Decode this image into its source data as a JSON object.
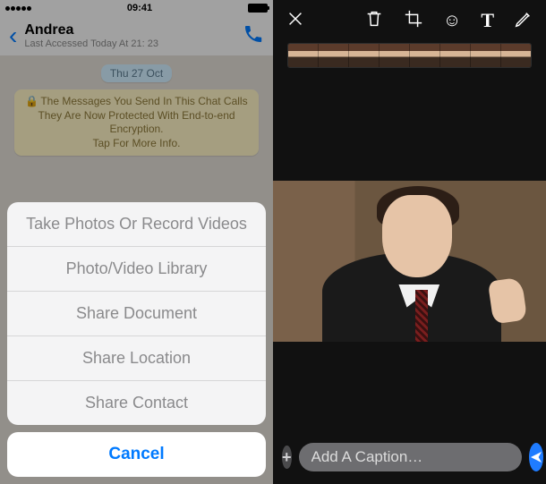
{
  "status": {
    "time": "09:41"
  },
  "chat": {
    "contact_name": "Andrea",
    "last_accessed": "Last Accessed Today At 21: 23",
    "date_label": "Thu 27 Oct",
    "encryption_line1": "The Messages You Send In This Chat Calls",
    "encryption_line2": "They Are Now Protected With End-to-end Encryption.",
    "encryption_line3": "Tap For More Info."
  },
  "action_sheet": {
    "items": [
      "Take Photos Or Record Videos",
      "Photo/Video Library",
      "Share Document",
      "Share Location",
      "Share Contact"
    ],
    "cancel": "Cancel"
  },
  "editor": {
    "caption_placeholder": "Add A Caption…",
    "tools": {
      "close": "close",
      "trash": "trash",
      "crop": "crop",
      "emoji": "emoji",
      "text": "T",
      "draw": "draw"
    },
    "filmstrip_frames": 8
  }
}
